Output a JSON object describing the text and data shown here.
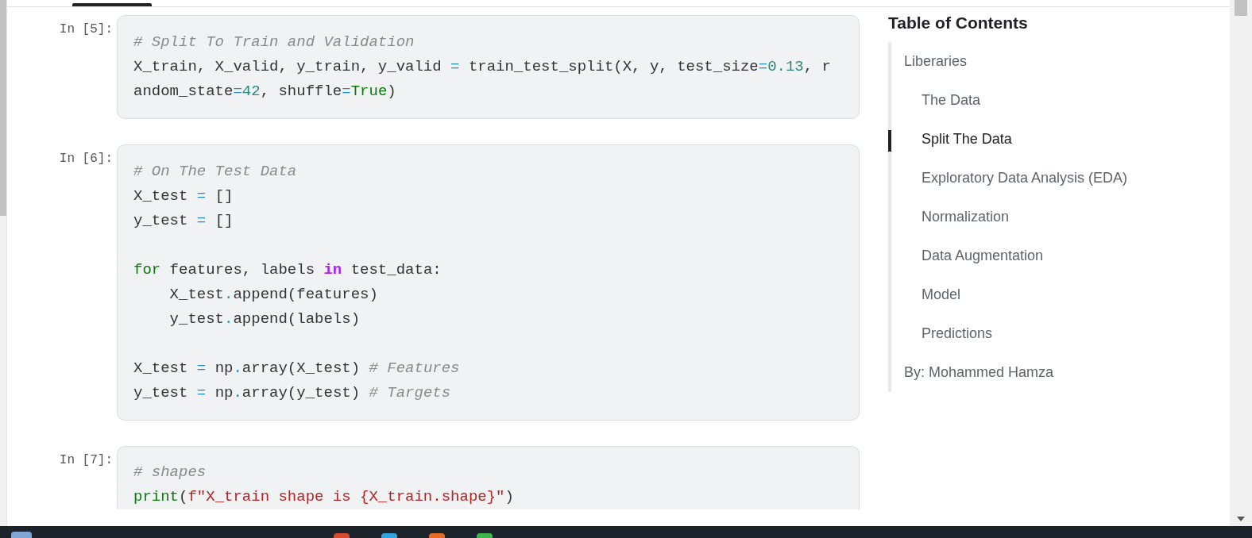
{
  "cells": [
    {
      "prompt": "In [5]:",
      "blocks": [
        [
          [
            {
              "text": "# Split To Train and Validation",
              "kind": "comment"
            }
          ],
          [
            {
              "text": "X_train, X_valid, y_train, y_valid ",
              "kind": "plain"
            },
            {
              "text": "=",
              "kind": "op"
            },
            {
              "text": " train_test_split(X, y, test_size",
              "kind": "plain"
            },
            {
              "text": "=",
              "kind": "op"
            },
            {
              "text": "0.13",
              "kind": "number"
            },
            {
              "text": ", r",
              "kind": "plain"
            }
          ],
          [
            {
              "text": "andom_state",
              "kind": "plain"
            },
            {
              "text": "=",
              "kind": "op"
            },
            {
              "text": "42",
              "kind": "number"
            },
            {
              "text": ", shuffle",
              "kind": "plain"
            },
            {
              "text": "=",
              "kind": "op"
            },
            {
              "text": "True",
              "kind": "keyword"
            },
            {
              "text": ")",
              "kind": "plain"
            }
          ]
        ]
      ]
    },
    {
      "prompt": "In [6]:",
      "blocks": [
        [
          [
            {
              "text": "# On The Test Data",
              "kind": "comment"
            }
          ],
          [
            {
              "text": "X_test ",
              "kind": "plain"
            },
            {
              "text": "=",
              "kind": "op"
            },
            {
              "text": " []",
              "kind": "plain"
            }
          ],
          [
            {
              "text": "y_test ",
              "kind": "plain"
            },
            {
              "text": "=",
              "kind": "op"
            },
            {
              "text": " []",
              "kind": "plain"
            }
          ]
        ],
        [
          [
            {
              "text": "for",
              "kind": "keyword"
            },
            {
              "text": " features, labels ",
              "kind": "plain"
            },
            {
              "text": "in",
              "kind": "operator_word"
            },
            {
              "text": " test_data:",
              "kind": "plain"
            }
          ],
          [
            {
              "text": "    X_test",
              "kind": "plain"
            },
            {
              "text": ".",
              "kind": "op"
            },
            {
              "text": "append(features)",
              "kind": "plain"
            }
          ],
          [
            {
              "text": "    y_test",
              "kind": "plain"
            },
            {
              "text": ".",
              "kind": "op"
            },
            {
              "text": "append(labels)",
              "kind": "plain"
            }
          ]
        ],
        [
          [
            {
              "text": "X_test ",
              "kind": "plain"
            },
            {
              "text": "=",
              "kind": "op"
            },
            {
              "text": " np",
              "kind": "plain"
            },
            {
              "text": ".",
              "kind": "op"
            },
            {
              "text": "array(X_test) ",
              "kind": "plain"
            },
            {
              "text": "# Features",
              "kind": "comment"
            }
          ],
          [
            {
              "text": "y_test ",
              "kind": "plain"
            },
            {
              "text": "=",
              "kind": "op"
            },
            {
              "text": " np",
              "kind": "plain"
            },
            {
              "text": ".",
              "kind": "op"
            },
            {
              "text": "array(y_test) ",
              "kind": "plain"
            },
            {
              "text": "# Targets",
              "kind": "comment"
            }
          ]
        ]
      ]
    },
    {
      "prompt": "In [7]:",
      "blocks": [
        [
          [
            {
              "text": "# shapes",
              "kind": "comment"
            }
          ],
          [
            {
              "text": "print",
              "kind": "keyword"
            },
            {
              "text": "(",
              "kind": "plain"
            },
            {
              "text": "f\"X_train shape is {X_train.shape}\"",
              "kind": "string"
            },
            {
              "text": ")",
              "kind": "plain"
            }
          ]
        ]
      ]
    }
  ],
  "toc": {
    "title": "Table of Contents",
    "items": [
      {
        "label": "Liberaries",
        "selected": false,
        "children": [
          {
            "label": "The Data",
            "selected": false
          },
          {
            "label": "Split The Data",
            "selected": true
          },
          {
            "label": "Exploratory Data Analysis (EDA)",
            "selected": false
          },
          {
            "label": "Normalization",
            "selected": false
          },
          {
            "label": "Data Augmentation",
            "selected": false
          },
          {
            "label": "Model",
            "selected": false
          },
          {
            "label": "Predictions",
            "selected": false
          }
        ]
      },
      {
        "label": "By: Mohammed Hamza",
        "selected": false
      }
    ]
  }
}
